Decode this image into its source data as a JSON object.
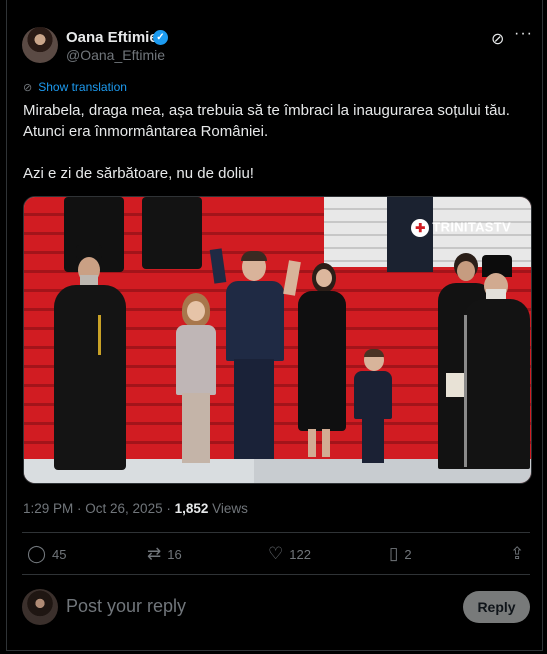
{
  "author": {
    "name": "Oana Eftimie",
    "handle": "@Oana_Eftimie",
    "verified_mark": "✓"
  },
  "header_icons": {
    "grok": "grok-icon",
    "more": "···"
  },
  "translation": {
    "label": "Show translation",
    "icon": "globe-icon"
  },
  "tweet": {
    "lines": [
      "Mirabela, draga mea, așa trebuia să te îmbraci la inaugurarea soțului tău.",
      "Atunci era înmormântarea României.",
      "Azi e zi de sărbătoare, nu de doliu!"
    ]
  },
  "media": {
    "watermark": "TRINITASTV",
    "colors": {
      "carpet": "#d11c22",
      "steps": "#e8e8e8"
    }
  },
  "meta": {
    "time": "1:29 PM",
    "separator": " · ",
    "date": "Oct 26, 2025",
    "dot": " · ",
    "views_count": "1,852",
    "views_label": " Views"
  },
  "actions": {
    "replies": "45",
    "reposts": "16",
    "likes": "122",
    "bookmarks": "2"
  },
  "reply_box": {
    "placeholder": "Post your reply",
    "button": "Reply"
  },
  "colors": {
    "accent": "#1d9bf0",
    "muted": "#71767b",
    "background": "#000000"
  }
}
